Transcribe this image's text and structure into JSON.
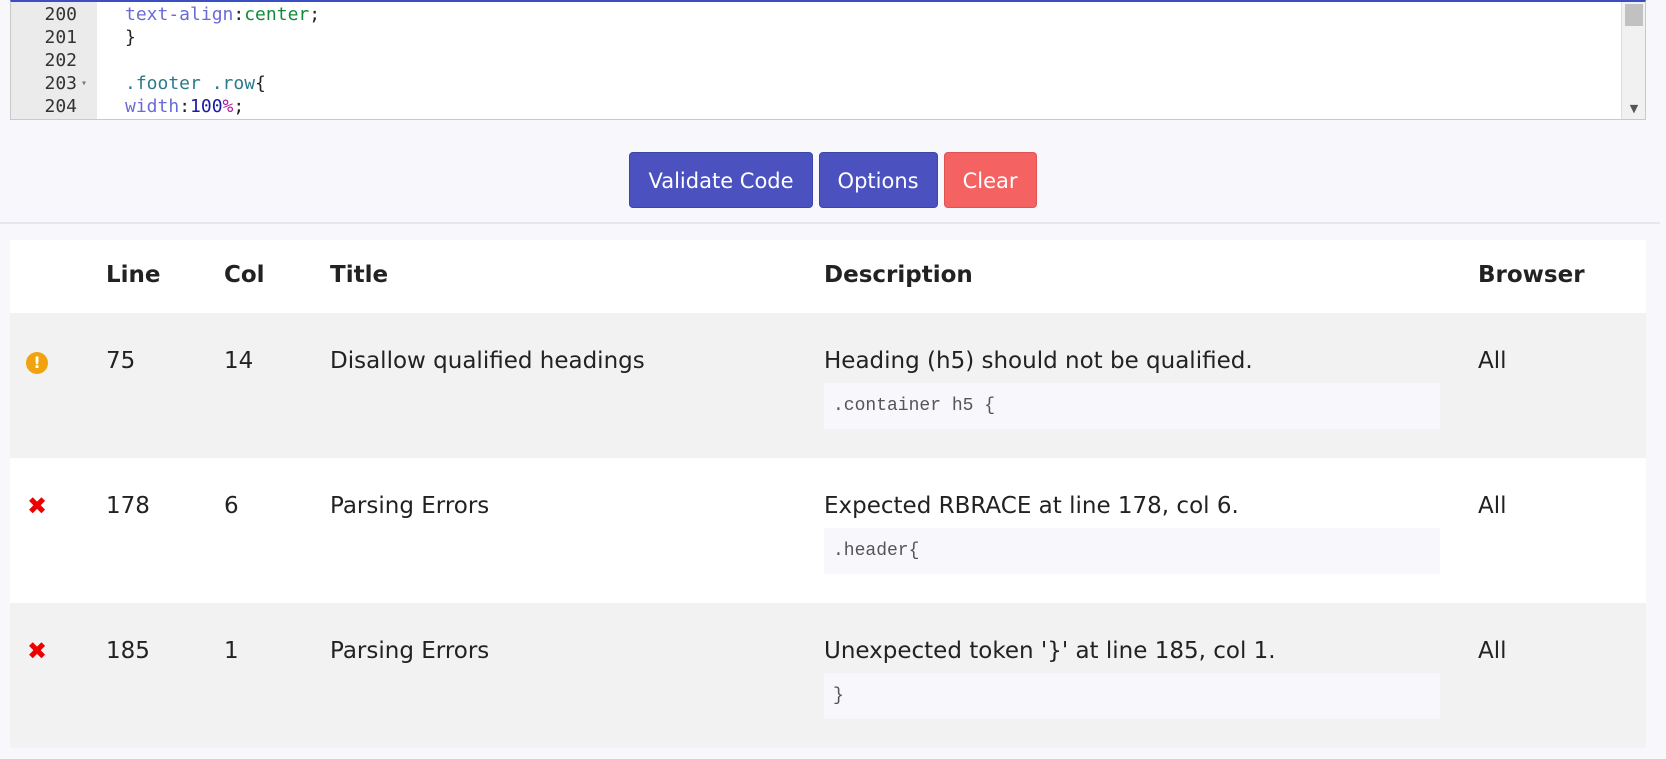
{
  "editor": {
    "lines": [
      {
        "num": "200",
        "fold": "",
        "tokens": [
          {
            "t": "text-align",
            "c": "prop"
          },
          {
            "t": ":",
            "c": "punct"
          },
          {
            "t": "center",
            "c": "val"
          },
          {
            "t": ";",
            "c": "punct"
          }
        ]
      },
      {
        "num": "201",
        "fold": "",
        "tokens": [
          {
            "t": "}",
            "c": "punct"
          }
        ]
      },
      {
        "num": "202",
        "fold": "",
        "tokens": []
      },
      {
        "num": "203",
        "fold": "▾",
        "tokens": [
          {
            "t": ".footer .row",
            "c": "sel"
          },
          {
            "t": "{",
            "c": "punct"
          }
        ]
      },
      {
        "num": "204",
        "fold": "",
        "tokens": [
          {
            "t": "width",
            "c": "prop"
          },
          {
            "t": ":",
            "c": "punct"
          },
          {
            "t": "100",
            "c": "num"
          },
          {
            "t": "%",
            "c": "unit"
          },
          {
            "t": ";",
            "c": "punct"
          }
        ]
      }
    ]
  },
  "actions": {
    "validate_label": "Validate Code",
    "options_label": "Options",
    "clear_label": "Clear"
  },
  "colors": {
    "primary": "#4b52c0",
    "danger": "#f46262",
    "warning": "#f1a30f",
    "error": "#e00000"
  },
  "table": {
    "headers": {
      "line": "Line",
      "col": "Col",
      "title": "Title",
      "description": "Description",
      "browser": "Browser"
    },
    "rows": [
      {
        "type": "warning",
        "icon": "warning-circle-icon",
        "line": "75",
        "col": "14",
        "title": "Disallow qualified headings",
        "description": "Heading (h5) should not be qualified.",
        "snippet": ".container h5 {",
        "browser": "All"
      },
      {
        "type": "error",
        "icon": "error-x-icon",
        "line": "178",
        "col": "6",
        "title": "Parsing Errors",
        "description": "Expected RBRACE at line 178, col 6.",
        "snippet": ".header{",
        "browser": "All"
      },
      {
        "type": "error",
        "icon": "error-x-icon",
        "line": "185",
        "col": "1",
        "title": "Parsing Errors",
        "description": "Unexpected token '}' at line 185, col 1.",
        "snippet": "}",
        "browser": "All"
      }
    ]
  }
}
